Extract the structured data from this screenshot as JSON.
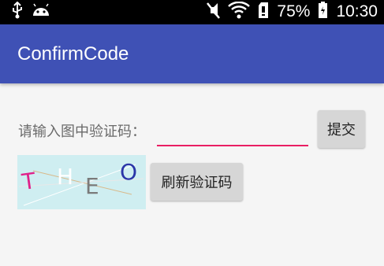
{
  "status_bar": {
    "battery": "75%",
    "time": "10:30",
    "icons": [
      "usb-icon",
      "android-icon",
      "mute-icon",
      "wifi-icon",
      "sim-icon",
      "battery-icon"
    ]
  },
  "app_bar": {
    "title": "ConfirmCode",
    "color": "#3f51b5"
  },
  "form": {
    "prompt": "请输入图中验证码：",
    "input_value": "",
    "input_underline_color": "#e91e63",
    "submit_label": "提交",
    "refresh_label": "刷新验证码"
  },
  "captcha": {
    "background": "#cfeef1",
    "chars": [
      {
        "char": "T",
        "color": "#e0218a"
      },
      {
        "char": "H",
        "color": "#ffffff"
      },
      {
        "char": "E",
        "color": "#7a7a7a"
      },
      {
        "char": "O",
        "color": "#2b35a8"
      }
    ]
  }
}
